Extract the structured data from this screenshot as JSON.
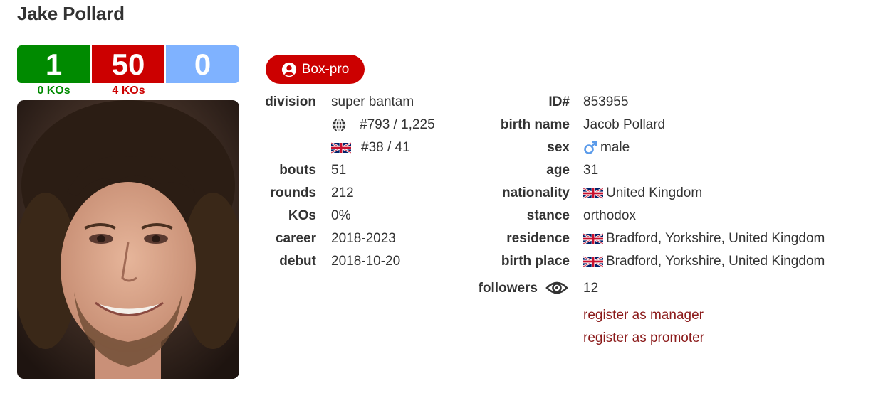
{
  "boxer": {
    "name": "Jake Pollard"
  },
  "record": {
    "wins": "1",
    "losses": "50",
    "draws": "0",
    "win_kos": "0 KOs",
    "loss_kos": "4 KOs"
  },
  "colors": {
    "win": "#008a00",
    "loss": "#cc0000",
    "draw": "#7fb2ff",
    "badge": "#cc0000",
    "link": "#8b1a1a"
  },
  "sport_badge": {
    "label": "Box-pro",
    "icon": "user-circle-icon"
  },
  "left_details": {
    "division_label": "division",
    "division": "super bantam",
    "world_rank": "#793 / 1,225",
    "country_rank": "#38 / 41",
    "bouts_label": "bouts",
    "bouts": "51",
    "rounds_label": "rounds",
    "rounds": "212",
    "kos_label": "KOs",
    "kos": "0%",
    "career_label": "career",
    "career": "2018-2023",
    "debut_label": "debut",
    "debut": "2018-10-20"
  },
  "right_details": {
    "id_label": "ID#",
    "id": "853955",
    "birth_name_label": "birth name",
    "birth_name": "Jacob Pollard",
    "sex_label": "sex",
    "sex": "male",
    "age_label": "age",
    "age": "31",
    "nationality_label": "nationality",
    "nationality": "United Kingdom",
    "stance_label": "stance",
    "stance": "orthodox",
    "residence_label": "residence",
    "residence": "Bradford, Yorkshire, United Kingdom",
    "birth_place_label": "birth place",
    "birth_place": "Bradford, Yorkshire, United Kingdom",
    "followers_label": "followers",
    "followers": "12"
  },
  "links": {
    "register_manager": "register as manager",
    "register_promoter": "register as promoter"
  }
}
